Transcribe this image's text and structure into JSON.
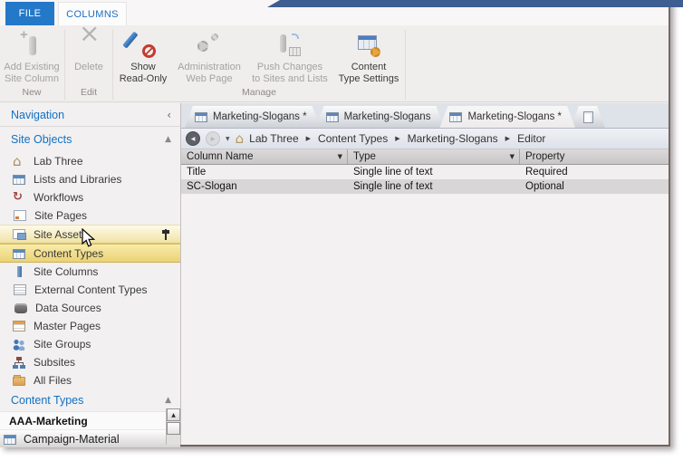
{
  "colors": {
    "accent_blue": "#2478c8",
    "nav_blue": "#1271c4",
    "titlebar_blue": "#3e5e92",
    "selection_yellow": "#ebd274"
  },
  "ribbon": {
    "file_tab": "FILE",
    "columns_tab": "COLUMNS",
    "groups": {
      "new": {
        "label": "New",
        "add_existing": {
          "line1": "Add Existing",
          "line2": "Site Column",
          "disabled": true,
          "icon": "add-column-icon"
        }
      },
      "edit": {
        "label": "Edit",
        "delete": {
          "line1": "Delete",
          "disabled": true,
          "icon": "delete-x-icon"
        }
      },
      "manage": {
        "label": "Manage",
        "show_read_only": {
          "line1": "Show",
          "line2": "Read-Only",
          "disabled": false,
          "icon": "pen-blocked-icon"
        },
        "admin_web_page": {
          "line1": "Administration",
          "line2": "Web Page",
          "disabled": true,
          "icon": "gears-icon"
        },
        "push_changes": {
          "line1": "Push Changes",
          "line2": "to Sites and Lists",
          "disabled": true,
          "icon": "push-changes-icon"
        },
        "content_type_settings": {
          "line1": "Content",
          "line2": "Type Settings",
          "disabled": false,
          "icon": "window-gear-icon"
        }
      }
    }
  },
  "sidebar": {
    "header": "Navigation",
    "site_objects": {
      "label": "Site Objects",
      "items": [
        {
          "label": "Lab Three",
          "icon": "home-icon"
        },
        {
          "label": "Lists and Libraries",
          "icon": "table-icon"
        },
        {
          "label": "Workflows",
          "icon": "workflow-icon"
        },
        {
          "label": "Site Pages",
          "icon": "page-icon"
        },
        {
          "label": "Site Assets",
          "icon": "assets-icon",
          "state": "hovered"
        },
        {
          "label": "Content Types",
          "icon": "table-icon",
          "state": "selected"
        },
        {
          "label": "Site Columns",
          "icon": "column-icon"
        },
        {
          "label": "External Content Types",
          "icon": "document-lines-icon"
        },
        {
          "label": "Data Sources",
          "icon": "database-icon"
        },
        {
          "label": "Master Pages",
          "icon": "master-page-icon"
        },
        {
          "label": "Site Groups",
          "icon": "people-icon"
        },
        {
          "label": "Subsites",
          "icon": "org-chart-icon"
        },
        {
          "label": "All Files",
          "icon": "folder-icon"
        }
      ]
    },
    "content_types_section": {
      "label": "Content Types",
      "items": [
        {
          "label": "AAA-Marketing",
          "bold": true
        },
        {
          "label": "Campaign-Material",
          "icon": "table-icon"
        }
      ]
    }
  },
  "doc_tabs": [
    {
      "label": "Marketing-Slogans *",
      "icon": "table-icon",
      "active": false
    },
    {
      "label": "Marketing-Slogans",
      "icon": "table-icon",
      "active": false
    },
    {
      "label": "Marketing-Slogans *",
      "icon": "table-icon",
      "active": true
    },
    {
      "label": "",
      "icon": "new-page-icon",
      "active": false
    }
  ],
  "breadcrumb": {
    "items": [
      "Lab Three",
      "Content Types",
      "Marketing-Slogans",
      "Editor"
    ]
  },
  "table": {
    "headers": [
      "Column Name",
      "Type",
      "Property"
    ],
    "rows": [
      {
        "column_name": "Title",
        "type": "Single line of text",
        "property": "Required"
      },
      {
        "column_name": "SC-Slogan",
        "type": "Single line of text",
        "property": "Optional"
      }
    ]
  }
}
